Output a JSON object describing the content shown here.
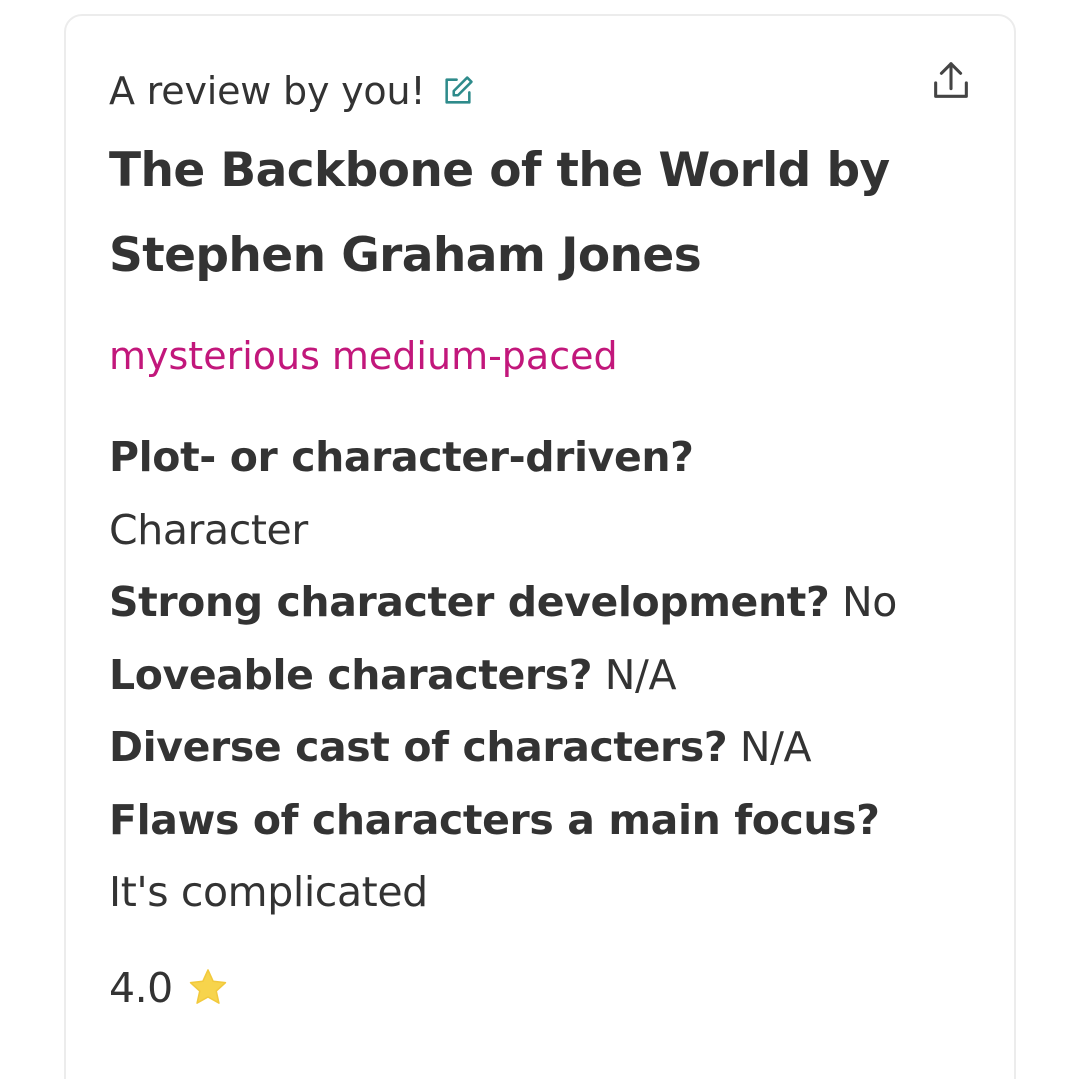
{
  "review": {
    "byline": "A review by you!",
    "title": "The Backbone of the World by Stephen Graham Jones",
    "moods": [
      "mysterious",
      "medium-paced"
    ],
    "questions": [
      {
        "question": "Plot- or character-driven?",
        "answer": "Character"
      },
      {
        "question": "Strong character development?",
        "answer": "No"
      },
      {
        "question": "Loveable characters?",
        "answer": "N/A"
      },
      {
        "question": "Diverse cast of characters?",
        "answer": "N/A"
      },
      {
        "question": "Flaws of characters a main focus?",
        "answer": "It's complicated"
      }
    ],
    "rating": "4.0"
  },
  "icons": {
    "edit": "edit-icon",
    "share": "share-icon",
    "star": "star-icon"
  },
  "colors": {
    "text": "#333333",
    "mood_accent": "#c2177b",
    "edit_icon": "#2e8b8b",
    "star": "#f7d44c"
  }
}
